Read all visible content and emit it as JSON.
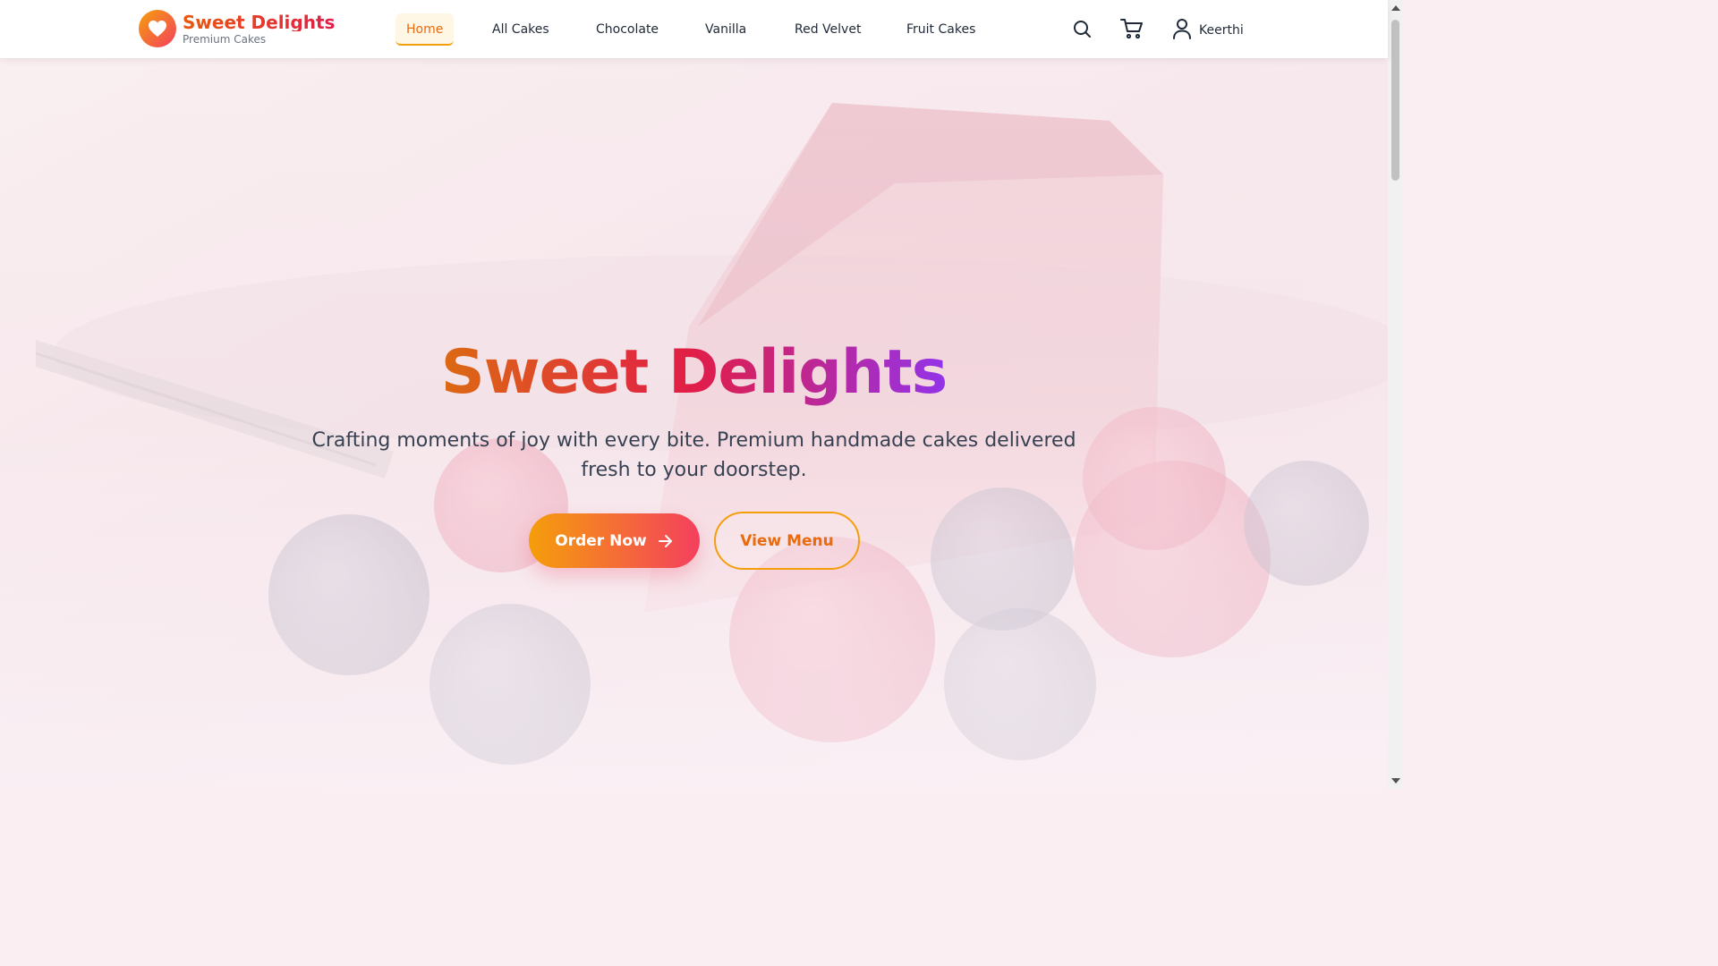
{
  "brand": {
    "title": "Sweet Delights",
    "subtitle": "Premium Cakes",
    "logo_icon": "heart-icon"
  },
  "nav": {
    "items": [
      {
        "label": "Home",
        "active": true
      },
      {
        "label": "All Cakes",
        "active": false
      },
      {
        "label": "Chocolate",
        "active": false
      },
      {
        "label": "Vanilla",
        "active": false
      },
      {
        "label": "Red Velvet",
        "active": false
      },
      {
        "label": "Fruit Cakes",
        "active": false
      }
    ]
  },
  "header_actions": {
    "search_icon": "search-icon",
    "cart_icon": "cart-icon",
    "user_icon": "user-icon",
    "user_name": "Keerthi"
  },
  "hero": {
    "title": "Sweet Delights",
    "subtitle": "Crafting moments of joy with every bite. Premium handmade cakes delivered fresh to your doorstep.",
    "primary_button": "Order Now",
    "secondary_button": "View Menu"
  },
  "colors": {
    "accent_orange": "#f59e0b",
    "accent_rose": "#f43f5e",
    "accent_purple": "#9333ea",
    "text_dark": "#1f2937"
  }
}
